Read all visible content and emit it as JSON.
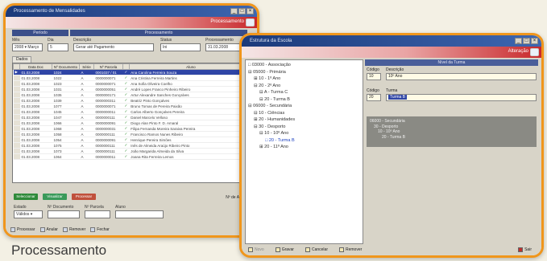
{
  "caption": "Processamento",
  "left_window": {
    "title": "Processamento de Mensalidades",
    "banner_title": "Processamento",
    "section_headers": [
      "Período",
      "Processamento"
    ],
    "fields": [
      {
        "label": "Mês",
        "value": "2008 ▾ Março"
      },
      {
        "label": "Dia",
        "value": "5"
      },
      {
        "label": "Descrição",
        "value": "Gerar até Pagamento"
      },
      {
        "label": "Status",
        "value": "Ini"
      },
      {
        "label": "Processamento",
        "value": "31.03.2008"
      }
    ],
    "tab_label": "Dados",
    "grid_columns": [
      "",
      "Data Doc",
      "Nº Documento",
      "Série",
      "Nº Parcela",
      "",
      "Aluno"
    ],
    "grid_rows": [
      {
        "date": "01.03.2008",
        "doc": "1024",
        "serie": "A",
        "parcela": "0001037 / 01",
        "aluno": "Ana Carolina Ferreira Souza",
        "selected": true
      },
      {
        "date": "01.03.2008",
        "doc": "1022",
        "serie": "A",
        "parcela": "0000000071",
        "aluno": "Ana Cristina Ferreira Martins",
        "selected": false
      },
      {
        "date": "01.03.2008",
        "doc": "1023",
        "serie": "A",
        "parcela": "0000000071",
        "aluno": "Ana Sofia Oliveira Coelho",
        "selected": false
      },
      {
        "date": "01.03.2008",
        "doc": "1031",
        "serie": "A",
        "parcela": "0000000051",
        "aluno": "André Lopes Franco Pinheiro Ribeiro",
        "selected": false
      },
      {
        "date": "01.03.2008",
        "doc": "1035",
        "serie": "A",
        "parcela": "0000000171",
        "aluno": "Artur Alexandre Sanches Gonçalves",
        "selected": false
      },
      {
        "date": "01.03.2008",
        "doc": "1039",
        "serie": "A",
        "parcela": "0000000311",
        "aluno": "Beatriz Pinto Gonçalves",
        "selected": false
      },
      {
        "date": "01.03.2008",
        "doc": "1077",
        "serie": "A",
        "parcela": "0000000071",
        "aluno": "Bruno Tomas de Pereira Paixão",
        "selected": false
      },
      {
        "date": "01.03.2008",
        "doc": "1045",
        "serie": "A",
        "parcela": "0000000011",
        "aluno": "Carlos Alberto Gonçalves Pereira",
        "selected": false
      },
      {
        "date": "01.03.2008",
        "doc": "1047",
        "serie": "A",
        "parcela": "0000000111",
        "aluno": "Daniel Marcelo Velloso",
        "selected": false
      },
      {
        "date": "01.03.2008",
        "doc": "1066",
        "serie": "A",
        "parcela": "0000000091",
        "aluno": "Diogo Alan Pinto F. D. Amaral",
        "selected": false
      },
      {
        "date": "01.03.2008",
        "doc": "1068",
        "serie": "A",
        "parcela": "0000000031",
        "aluno": "Filipa Fernanda Moreira Saraiva Pereira",
        "selected": false
      },
      {
        "date": "01.03.2008",
        "doc": "1058",
        "serie": "A",
        "parcela": "0000000111",
        "aluno": "Francisco Ramos Nunes Ribeiro",
        "selected": false
      },
      {
        "date": "01.03.2008",
        "doc": "1054",
        "serie": "A",
        "parcela": "0000000091",
        "aluno": "Henrique Pereira Simões",
        "selected": false
      },
      {
        "date": "01.03.2008",
        "doc": "1075",
        "serie": "A",
        "parcela": "0000000111",
        "aluno": "Inês de Almeida Araújo Ribeiro Pinto",
        "selected": false
      },
      {
        "date": "01.03.2008",
        "doc": "1073",
        "serie": "A",
        "parcela": "0000000111",
        "aluno": "João Margarida Almeida da Silva",
        "selected": false
      },
      {
        "date": "01.03.2008",
        "doc": "1064",
        "serie": "A",
        "parcela": "0000000011",
        "aluno": "Joana Rita Ferreira Lemos",
        "selected": false
      }
    ],
    "action_buttons": [
      {
        "label": "Seleccionar",
        "color": "#2f8a3a"
      },
      {
        "label": "Visualizar",
        "color": "#3a9a5a"
      },
      {
        "label": "Processar",
        "color": "#c0503c"
      }
    ],
    "count_label": "Nº de Alunos",
    "bottom_fields": [
      {
        "label": "Estado",
        "value": "Válidos ▾"
      },
      {
        "label": "Nº Documento",
        "value": ""
      },
      {
        "label": "Nº Parcela",
        "value": ""
      },
      {
        "label": "Aluno",
        "value": ""
      }
    ],
    "toolbar": [
      "Processar",
      "Anular",
      "Remover",
      "Fechar"
    ]
  },
  "right_window": {
    "title": "Estrutura da Escola",
    "banner_title": "Alteração",
    "tree": [
      {
        "text": "□ 03000 - Associação",
        "level": 0
      },
      {
        "text": "⊟ 05000 - Primária",
        "level": 0
      },
      {
        "text": "⊞ 10 - 1º Ano",
        "level": 1
      },
      {
        "text": "⊟ 20 - 2º Ano",
        "level": 1
      },
      {
        "text": "⊟ A - Turma C",
        "level": 2
      },
      {
        "text": "⊟ 20 - Turma B",
        "level": 2
      },
      {
        "text": "⊟ 06000 - Secundária",
        "level": 0
      },
      {
        "text": "⊟ 10 - Ciências",
        "level": 1
      },
      {
        "text": "⊞ 20 - Humanidades",
        "level": 1
      },
      {
        "text": "⊟ 30 - Desporto",
        "level": 1
      },
      {
        "text": "⊟ 10 - 10º Ano",
        "level": 2
      },
      {
        "text": "□ 20 - Turma B",
        "level": 3,
        "selected": true
      },
      {
        "text": "⊞ 20 - 11º Ano",
        "level": 2
      }
    ],
    "panel_title": "Nível da Turma",
    "code_label": "Código",
    "code_value": "10",
    "desc_label": "Descrição",
    "desc_value": "10º Ano",
    "code2_label": "Código",
    "code2_value": "20",
    "turma_label": "Turma",
    "turma_value": "Turma B",
    "path_lines": [
      "06000 - Secundária",
      "30 - Desporto",
      "10 - 10º Ano",
      "20 - Turma B"
    ],
    "status_items": [
      "Novo",
      "Gravar",
      "Cancelar",
      "Remover"
    ],
    "exit_label": "Sair"
  }
}
